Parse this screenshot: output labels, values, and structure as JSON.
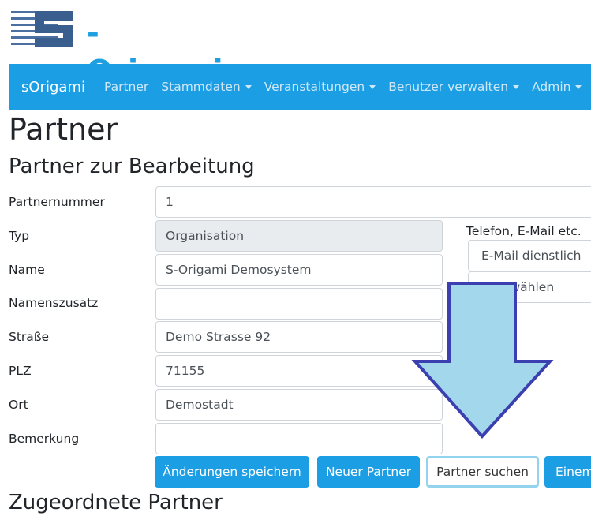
{
  "logo": {
    "text": "-Origami"
  },
  "navbar": {
    "brand": "sOrigami",
    "items": [
      {
        "label": "Partner"
      },
      {
        "label": "Stammdaten"
      },
      {
        "label": "Veranstaltungen"
      },
      {
        "label": "Benutzer verwalten"
      },
      {
        "label": "Admin"
      }
    ]
  },
  "page": {
    "title": "Partner",
    "section_title": "Partner zur Bearbeitung",
    "subsection_title": "Zugeordnete Partner"
  },
  "form": {
    "partnernummer": {
      "label": "Partnernummer",
      "value": "1"
    },
    "typ": {
      "label": "Typ",
      "value": "Organisation"
    },
    "name": {
      "label": "Name",
      "value": "S-Origami Demosystem"
    },
    "namenszusatz": {
      "label": "Namenszusatz",
      "value": ""
    },
    "strasse": {
      "label": "Straße",
      "value": "Demo Strasse 92"
    },
    "plz": {
      "label": "PLZ",
      "value": "71155"
    },
    "ort": {
      "label": "Ort",
      "value": "Demostadt"
    },
    "bemerkung": {
      "label": "Bemerkung",
      "value": ""
    }
  },
  "contact": {
    "label": "Telefon, E-Mail etc.",
    "type_select": "E-Mail dienstlich",
    "second_select": "Auswählen"
  },
  "buttons": {
    "save": "Änderungen speichern",
    "new_partner": "Neuer Partner",
    "search_partner": "Partner suchen",
    "more": "Einem"
  },
  "annotation": {
    "arrow_color": "#a3d8ec",
    "arrow_stroke": "#3b3fb0"
  },
  "colors": {
    "primary": "#1c9ee4"
  }
}
